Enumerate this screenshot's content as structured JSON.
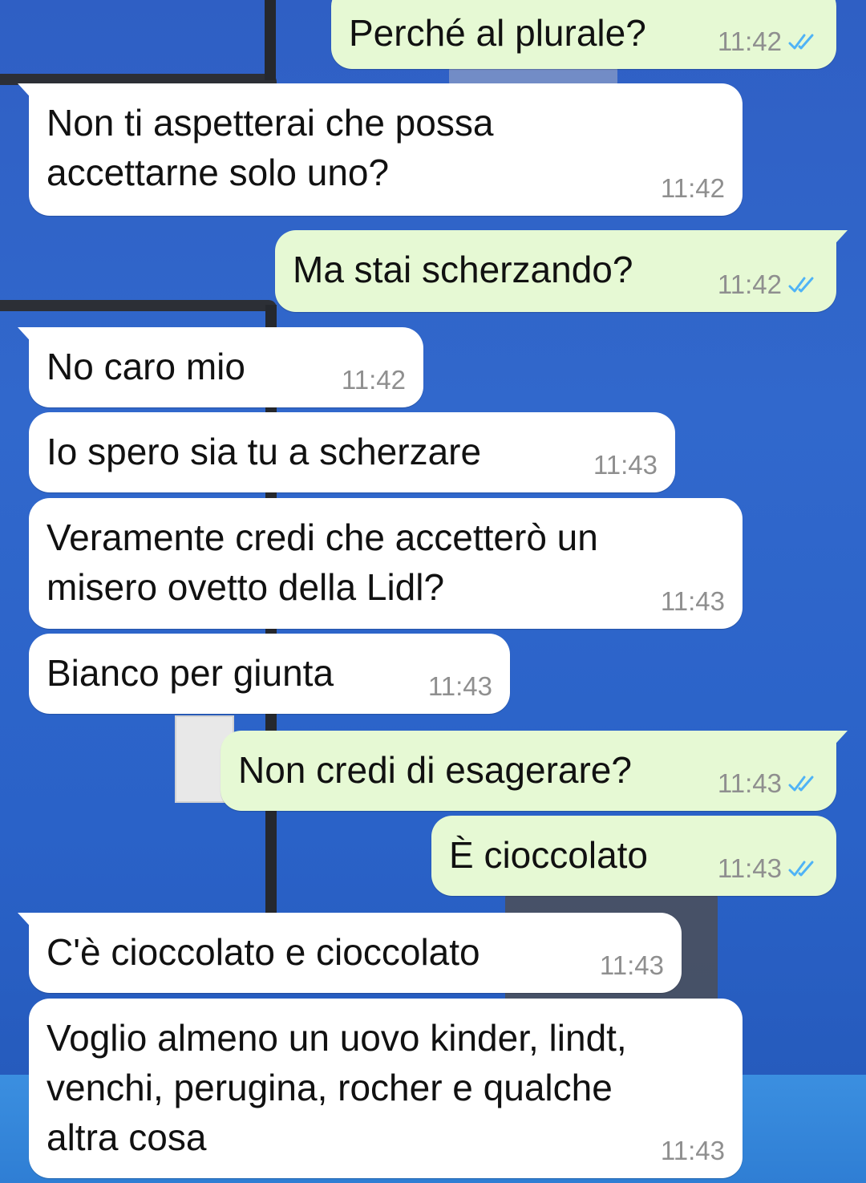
{
  "chat": {
    "messages": [
      {
        "dir": "out",
        "text": "Perché al plurale?",
        "time": "11:42",
        "read_icon": "double-check-icon"
      },
      {
        "dir": "in",
        "text": "Non ti aspetterai che possa\naccettarne solo uno?",
        "time": "11:42"
      },
      {
        "dir": "out",
        "text": "Ma stai scherzando?",
        "time": "11:42",
        "read_icon": "double-check-icon"
      },
      {
        "dir": "in",
        "text": "No caro mio",
        "time": "11:42"
      },
      {
        "dir": "in",
        "text": "Io spero sia tu a scherzare",
        "time": "11:43"
      },
      {
        "dir": "in",
        "text": "Veramente credi che accetterò un\nmisero ovetto della Lidl?",
        "time": "11:43"
      },
      {
        "dir": "in",
        "text": "Bianco per giunta",
        "time": "11:43"
      },
      {
        "dir": "out",
        "text": "Non credi di esagerare?",
        "time": "11:43",
        "read_icon": "double-check-icon"
      },
      {
        "dir": "out",
        "text": "È cioccolato",
        "time": "11:43",
        "read_icon": "double-check-icon"
      },
      {
        "dir": "in",
        "text": "C'è cioccolato e cioccolato",
        "time": "11:43"
      },
      {
        "dir": "in",
        "text": "Voglio almeno un uovo kinder, lindt,\nvenchi, perugina, rocher e qualche\naltra cosa",
        "time": "11:43"
      }
    ]
  },
  "colors": {
    "incoming_bubble": "#ffffff",
    "outgoing_bubble": "#e6f9d4",
    "read_check": "#4fb3f6",
    "timestamp": "#8f8f8f",
    "wallpaper": "#2f62c6"
  }
}
